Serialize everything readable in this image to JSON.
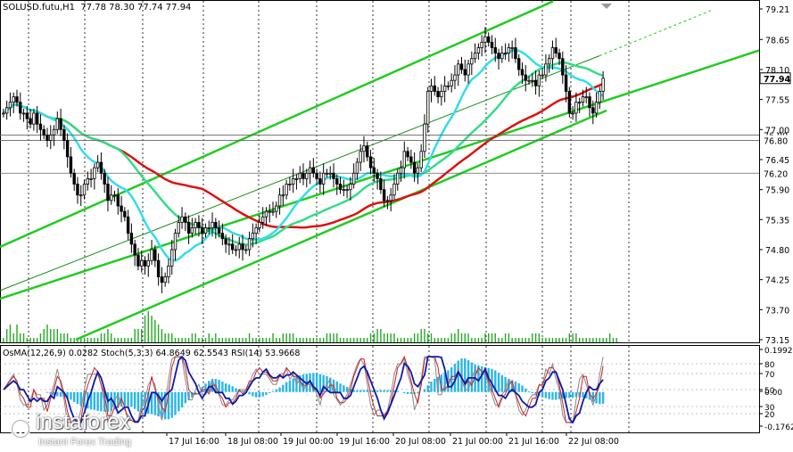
{
  "header": {
    "symbol": "SOLUSD.futu,H1",
    "ohlc": "77.78 78.30 77.74 77.94"
  },
  "indicator_header": {
    "osma": "OsMA(12,26,9) 0.0282",
    "stoch": "Stoch(5,3,3) 64.8649 62.5543",
    "rsi": "RSI(14) 53.9668"
  },
  "branding": {
    "name": "instaforex",
    "tagline": "Instant Forex Trading"
  },
  "colors": {
    "channel": "#22cc22",
    "ma_red": "#dd1111",
    "ma_cyan": "#33dde8",
    "ma_green": "#33dd88",
    "candle": "#000000",
    "volume": "#22aa22",
    "histogram": "#29b6e8",
    "rsi": "#0a1aa8",
    "stoch_main": "#888888",
    "stoch_signal": "#cc2222",
    "grid": "#000000"
  },
  "chart_data": [
    {
      "type": "candlestick",
      "title": "SOLUSD.futu,H1",
      "ylim": [
        73.15,
        79.21
      ],
      "y_ticks": [
        "79.21",
        "78.65",
        "78.10",
        "77.55",
        "77.00",
        "76.45",
        "75.90",
        "75.35",
        "74.80",
        "74.25",
        "73.70",
        "73.15"
      ],
      "x_ticks": [
        "17 Jul 16:00",
        "18 Jul 08:00",
        "19 Jul 00:00",
        "19 Jul 16:00",
        "20 Jul 08:00",
        "21 Jul 00:00",
        "21 Jul 16:00",
        "22 Jul 08:00"
      ],
      "price_labels": [
        {
          "value": 77.94,
          "label": "77.94",
          "style": "current"
        },
        {
          "value": 76.9,
          "label": "76.90",
          "style": "level"
        },
        {
          "value": 76.8,
          "label": "76.80",
          "style": "level"
        },
        {
          "value": 76.2,
          "label": "76.20",
          "style": "level"
        }
      ],
      "close_series": [
        77.3,
        77.4,
        77.5,
        77.6,
        77.5,
        77.3,
        77.3,
        77.2,
        77.1,
        77.3,
        77.1,
        77.0,
        76.9,
        76.8,
        76.9,
        77.0,
        77.2,
        77.0,
        76.8,
        76.5,
        76.2,
        76.0,
        75.8,
        75.8,
        76.0,
        76.1,
        76.1,
        76.3,
        76.4,
        76.2,
        76.0,
        75.7,
        75.8,
        75.8,
        75.6,
        75.5,
        75.4,
        75.1,
        74.9,
        74.7,
        74.5,
        74.6,
        74.5,
        74.6,
        74.8,
        74.6,
        74.3,
        74.2,
        74.3,
        74.5,
        74.8,
        75.1,
        75.3,
        75.4,
        75.3,
        75.1,
        75.2,
        75.3,
        75.2,
        75.1,
        75.2,
        75.2,
        75.3,
        75.2,
        75.1,
        75.0,
        74.9,
        74.9,
        74.8,
        74.8,
        74.9,
        74.8,
        74.8,
        75.0,
        75.1,
        75.2,
        75.3,
        75.4,
        75.5,
        75.5,
        75.5,
        75.6,
        75.8,
        75.8,
        76.0,
        76.0,
        76.1,
        76.1,
        76.2,
        76.1,
        76.2,
        76.3,
        76.2,
        76.1,
        76.0,
        76.2,
        76.2,
        76.2,
        76.1,
        76.0,
        75.9,
        75.9,
        75.9,
        76.0,
        76.2,
        76.4,
        76.6,
        76.7,
        76.5,
        76.3,
        76.2,
        76.1,
        75.9,
        75.7,
        75.7,
        75.8,
        76.0,
        76.2,
        76.3,
        76.6,
        76.5,
        76.4,
        76.2,
        76.3,
        76.6,
        77.1,
        77.7,
        77.8,
        77.7,
        77.6,
        77.7,
        77.8,
        77.8,
        77.9,
        78.0,
        78.2,
        78.1,
        78.0,
        78.2,
        78.3,
        78.4,
        78.5,
        78.6,
        78.7,
        78.6,
        78.5,
        78.4,
        78.3,
        78.4,
        78.4,
        78.5,
        78.5,
        78.3,
        78.1,
        78.0,
        77.9,
        77.9,
        77.9,
        77.8,
        78.0,
        78.0,
        78.2,
        78.3,
        78.5,
        78.4,
        78.3,
        78.0,
        77.7,
        77.3,
        77.3,
        77.5,
        77.5,
        77.6,
        77.6,
        77.4,
        77.3,
        77.5,
        77.7,
        77.94
      ],
      "volumes": [
        1,
        3,
        4,
        2,
        4,
        2,
        2,
        1,
        1,
        1,
        1,
        2,
        3,
        4,
        3,
        3,
        3,
        2,
        2,
        2,
        1,
        1,
        1,
        1,
        1,
        1,
        1,
        1,
        1,
        2,
        2,
        3,
        2,
        1,
        1,
        1,
        1,
        1,
        1,
        3,
        3,
        3,
        6,
        7,
        6,
        5,
        4,
        3,
        2,
        2,
        2,
        1,
        1,
        1,
        1,
        1,
        2,
        2,
        1,
        1,
        1,
        2,
        1,
        2,
        1,
        1,
        1,
        1,
        1,
        1,
        1,
        1,
        1,
        2,
        1,
        1,
        1,
        1,
        1,
        1,
        2,
        1,
        1,
        2,
        2,
        2,
        2,
        1,
        1,
        1,
        1,
        1,
        1,
        1,
        1,
        1,
        2,
        2,
        2,
        2,
        1,
        1,
        1,
        1,
        1,
        1,
        1,
        1,
        1,
        2,
        2,
        3,
        3,
        2,
        2,
        2,
        2,
        1,
        1,
        1,
        1,
        1,
        2,
        2,
        3,
        3,
        2,
        2,
        1,
        1,
        1,
        1,
        1,
        2,
        2,
        3,
        2,
        2,
        2,
        1,
        1,
        1,
        1,
        2,
        2,
        2,
        2,
        1,
        1,
        2,
        2,
        1,
        1,
        1,
        1,
        1,
        1,
        2,
        2,
        2,
        1,
        1,
        1,
        1,
        1,
        1,
        1,
        1,
        2,
        2,
        2,
        1,
        1,
        1,
        1,
        1,
        1,
        1,
        1,
        1,
        2,
        1,
        1
      ]
    },
    {
      "type": "indicator",
      "title": "OsMA(12,26,9) / Stoch(5,3,3) / RSI(14)",
      "ylim": [
        -0.1762,
        0.1992
      ],
      "y_ticks": [
        "0.1992",
        "80",
        "70",
        "50",
        "0.00",
        "30",
        "20",
        "-0.1762"
      ]
    }
  ]
}
